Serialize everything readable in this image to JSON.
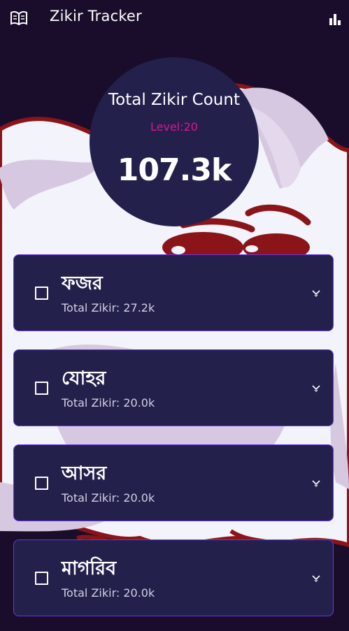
{
  "app": {
    "title": "Zikir Tracker",
    "book_icon": "book-icon",
    "stats_icon": "bar-chart-icon"
  },
  "summary": {
    "label": "Total Zikir Count",
    "level": "Level:20",
    "count": "107.3k"
  },
  "prayers": [
    {
      "name": "ফজর",
      "total": "Total Zikir: 27.2k",
      "checked": false
    },
    {
      "name": "যোহর",
      "total": "Total Zikir: 20.0k",
      "checked": false
    },
    {
      "name": "আসর",
      "total": "Total Zikir: 20.0k",
      "checked": false
    },
    {
      "name": "মাগরিব",
      "total": "Total Zikir: 20.0k",
      "checked": false
    }
  ],
  "colors": {
    "background": "#1a0d2c",
    "card": "#23204c",
    "card_border": "#6b35e8",
    "level": "#e0148f",
    "illustration_red": "#8b1418",
    "illustration_cloud": "#f2f3fb"
  }
}
